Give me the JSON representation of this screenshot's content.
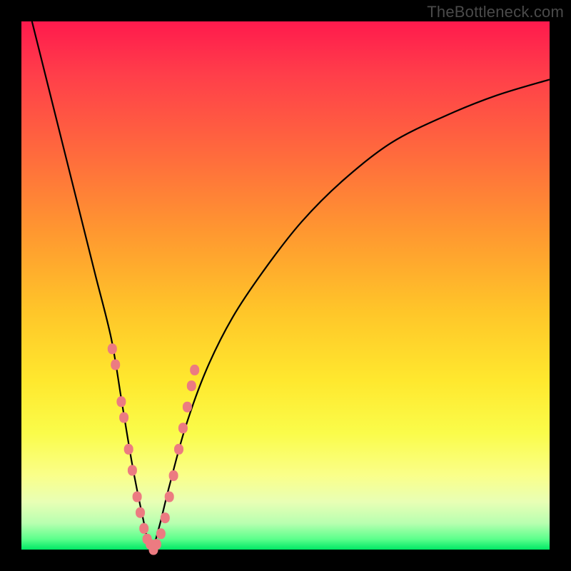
{
  "watermark": "TheBottleneck.com",
  "chart_data": {
    "type": "line",
    "title": "",
    "xlabel": "",
    "ylabel": "",
    "xlim": [
      0,
      100
    ],
    "ylim": [
      0,
      100
    ],
    "note": "Axes unlabeled; x roughly component-ratio index, y roughly bottleneck severity. Curve minimum near x≈25. Values estimated from pixel positions.",
    "series": [
      {
        "name": "bottleneck-curve",
        "x": [
          2,
          5,
          8,
          11,
          14,
          17,
          19,
          21,
          23,
          24.5,
          26,
          28,
          31,
          35,
          40,
          46,
          53,
          61,
          70,
          80,
          90,
          100
        ],
        "y": [
          100,
          88,
          76,
          64,
          52,
          40,
          28,
          16,
          6,
          0,
          4,
          12,
          23,
          34,
          44,
          53,
          62,
          70,
          77,
          82,
          86,
          89
        ]
      }
    ],
    "highlight_points": {
      "name": "near-minimum-markers",
      "x": [
        17.2,
        17.8,
        18.9,
        19.4,
        20.3,
        21.0,
        21.9,
        22.5,
        23.2,
        23.8,
        24.4,
        25.0,
        25.6,
        26.4,
        27.2,
        28.0,
        28.8,
        29.8,
        30.6,
        31.4,
        32.2,
        32.8
      ],
      "y": [
        38,
        35,
        28,
        25,
        19,
        15,
        10,
        7,
        4,
        2,
        1,
        0,
        1,
        3,
        6,
        10,
        14,
        19,
        23,
        27,
        31,
        34
      ]
    },
    "background_gradient": {
      "top": "#ff1a4d",
      "mid": "#ffe82e",
      "bottom": "#00e865"
    }
  }
}
